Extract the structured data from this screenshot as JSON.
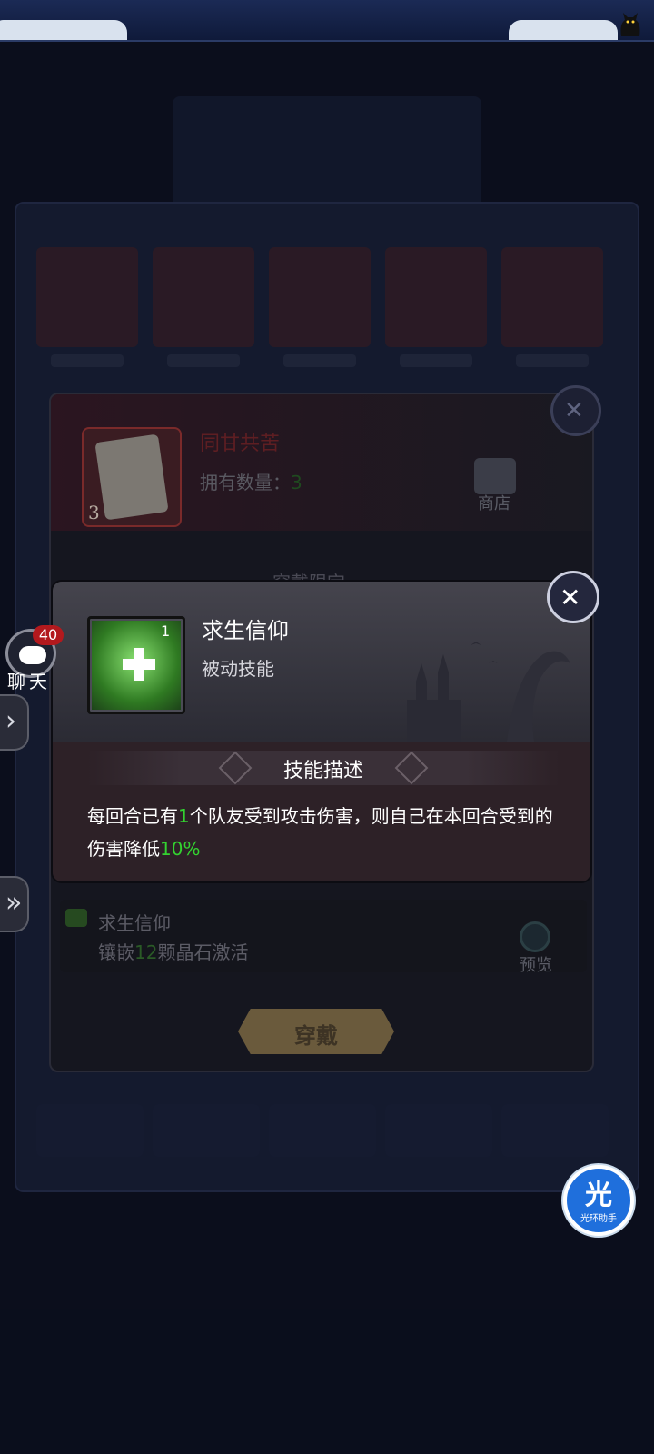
{
  "outer": {
    "item_name": "同甘共苦",
    "item_count": "3",
    "own_label": "拥有数量：",
    "own_value": "3",
    "shop_label": "商店",
    "wear_limit": "穿戴限定",
    "skill_row_name": "求生信仰",
    "skill_row_desc_pre": "镶嵌",
    "skill_row_desc_num": "12",
    "skill_row_desc_post": "颗晶石激活",
    "preview_label": "预览",
    "wear_button": "穿戴"
  },
  "popup": {
    "skill_name": "求生信仰",
    "skill_type": "被动技能",
    "skill_level": "1",
    "section_title": "技能描述",
    "desc_part1": "每回合已有",
    "desc_num1": "1",
    "desc_part2": "个队友受到攻击伤害，则自己在本回合受到的伤害降低",
    "desc_num2": "10%"
  },
  "chat": {
    "badge": "40",
    "label": "聊天"
  },
  "assistant": {
    "main": "光",
    "sub": "光环助手"
  },
  "colors": {
    "highlight_green": "#33d230",
    "badge_red": "#b3191d",
    "assistant_blue": "#1f6fdc"
  }
}
